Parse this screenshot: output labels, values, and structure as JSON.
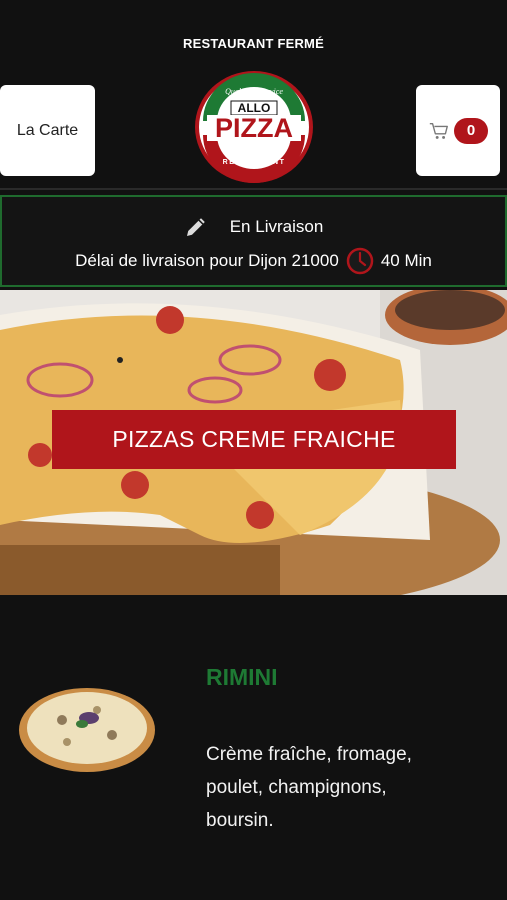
{
  "header": {
    "status": "RESTAURANT FERMÉ",
    "menu_button": "La Carte",
    "cart_count": "0",
    "logo": {
      "top_arc": "Qualité & Service",
      "word1": "ALLO",
      "word2": "PIZZA",
      "bottom_arc": "RESTAURANT"
    }
  },
  "delivery": {
    "mode": "En Livraison",
    "delay_text": "Délai de livraison pour Dijon 21000",
    "delay_value": "40 Min",
    "icons": [
      "pencil-icon",
      "clock-icon"
    ]
  },
  "category": {
    "title": "PIZZAS CREME FRAICHE"
  },
  "product": {
    "name": "RIMINI",
    "description": "Crème fraîche, fromage, poulet, champignons, boursin."
  },
  "colors": {
    "accent_red": "#b0151b",
    "brand_green": "#1e7a34",
    "background": "#111111"
  }
}
